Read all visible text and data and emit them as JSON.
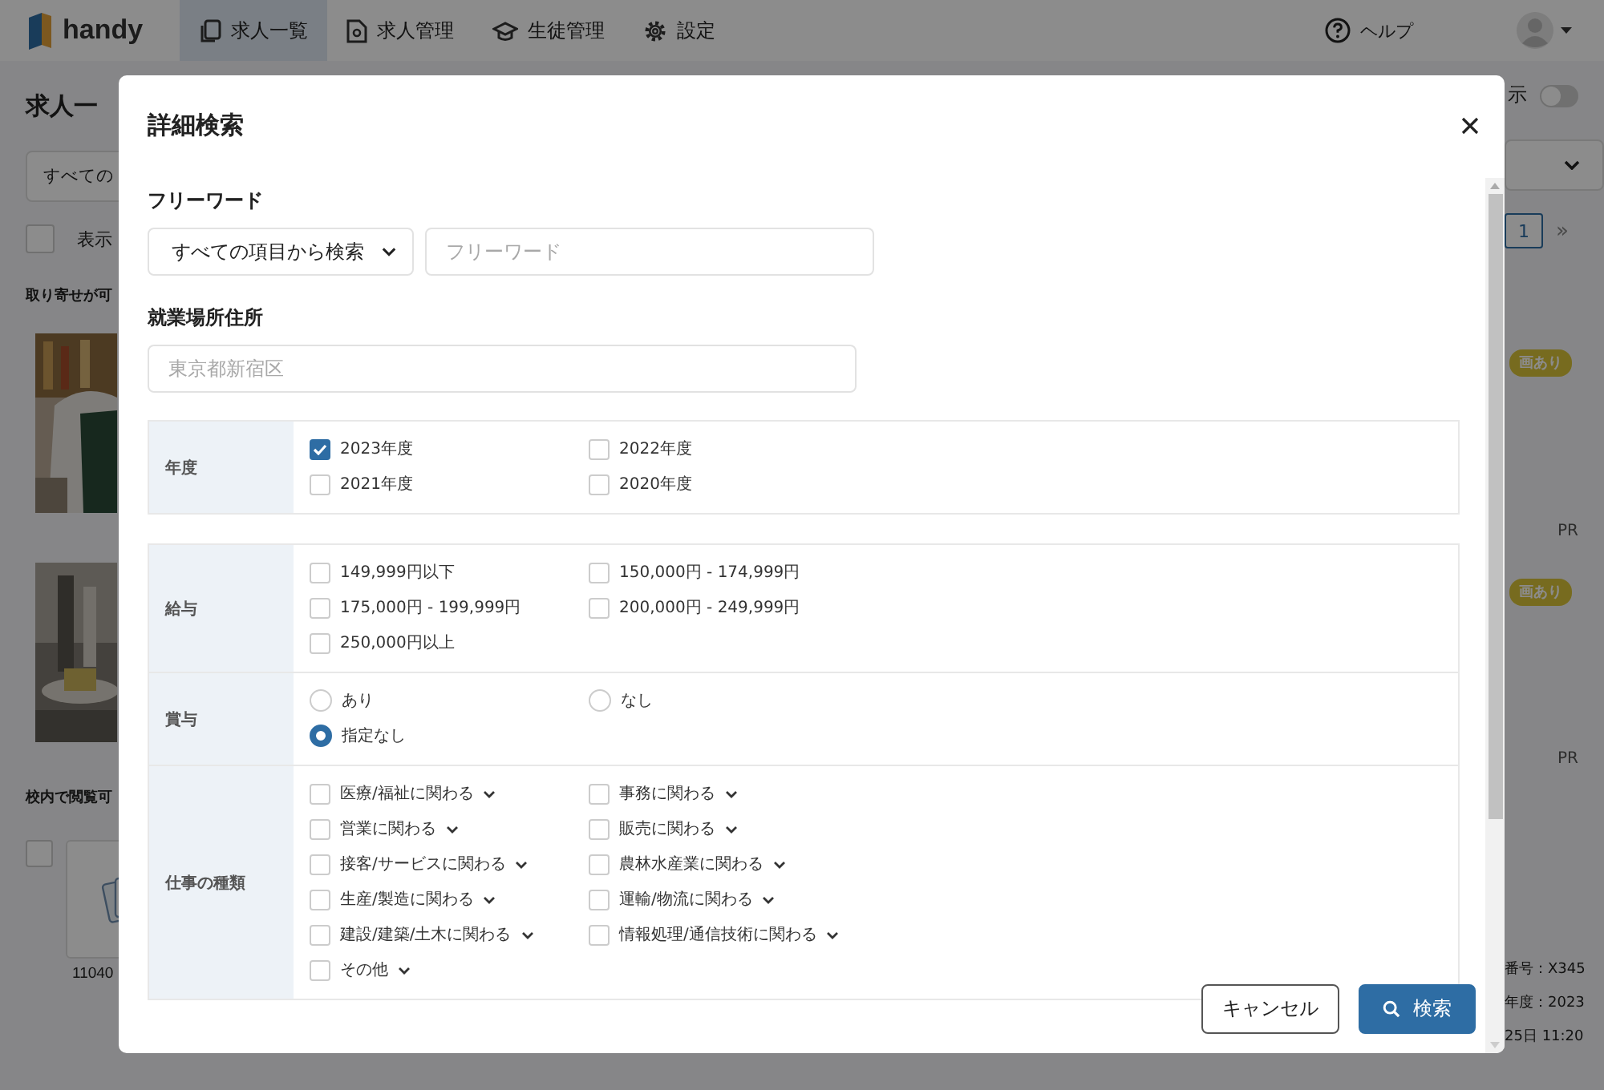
{
  "header": {
    "logo": "handy",
    "nav": [
      {
        "label": "求人一覧",
        "selected": true
      },
      {
        "label": "求人管理",
        "selected": false
      },
      {
        "label": "生徒管理",
        "selected": false
      },
      {
        "label": "設定",
        "selected": false
      }
    ],
    "help": "ヘルプ"
  },
  "page": {
    "title": "求人一",
    "filter": "すべての",
    "select_all": "表示",
    "select_all_checked": false,
    "card_checked": false,
    "section_1": "取り寄せが可",
    "section_2": "校内で閲覧可",
    "card_id": "11040",
    "toggle_label": "示",
    "toggle_on": false,
    "page_number": "1",
    "next": "»",
    "badges": [
      "画あり",
      "画あり"
    ],
    "pr": [
      "PR",
      "PR"
    ],
    "meta": [
      "番号：X345",
      "年度：2023",
      "25日 11:20"
    ]
  },
  "modal": {
    "title": "詳細検索",
    "freeword": {
      "label": "フリーワード",
      "scope": "すべての項目から検索",
      "placeholder": "フリーワード"
    },
    "address": {
      "label": "就業場所住所",
      "placeholder": "東京都新宿区"
    },
    "tables": [
      {
        "rows": [
          {
            "label": "年度",
            "options": [
              {
                "kind": "checkbox",
                "label": "2023年度",
                "checked": true
              },
              {
                "kind": "checkbox",
                "label": "2022年度",
                "checked": false
              },
              {
                "kind": "checkbox",
                "label": "2021年度",
                "checked": false
              },
              {
                "kind": "checkbox",
                "label": "2020年度",
                "checked": false
              }
            ]
          }
        ]
      },
      {
        "rows": [
          {
            "label": "給与",
            "options": [
              {
                "kind": "checkbox",
                "label": "149,999円以下",
                "checked": false
              },
              {
                "kind": "checkbox",
                "label": "150,000円 - 174,999円",
                "checked": false
              },
              {
                "kind": "checkbox",
                "label": "175,000円 - 199,999円",
                "checked": false
              },
              {
                "kind": "checkbox",
                "label": "200,000円 - 249,999円",
                "checked": false
              },
              {
                "kind": "checkbox",
                "label": "250,000円以上",
                "checked": false
              }
            ]
          },
          {
            "label": "賞与",
            "options": [
              {
                "kind": "radio",
                "label": "あり",
                "checked": false
              },
              {
                "kind": "radio",
                "label": "なし",
                "checked": false
              },
              {
                "kind": "radio",
                "label": "指定なし",
                "checked": true
              }
            ]
          },
          {
            "label": "仕事の種類",
            "options": [
              {
                "kind": "expandable",
                "label": "医療/福祉に関わる",
                "checked": false
              },
              {
                "kind": "expandable",
                "label": "事務に関わる",
                "checked": false
              },
              {
                "kind": "expandable",
                "label": "営業に関わる",
                "checked": false
              },
              {
                "kind": "expandable",
                "label": "販売に関わる",
                "checked": false
              },
              {
                "kind": "expandable",
                "label": "接客/サービスに関わる",
                "checked": false
              },
              {
                "kind": "expandable",
                "label": "農林水産業に関わる",
                "checked": false
              },
              {
                "kind": "expandable",
                "label": "生産/製造に関わる",
                "checked": false
              },
              {
                "kind": "expandable",
                "label": "運輸/物流に関わる",
                "checked": false
              },
              {
                "kind": "expandable",
                "label": "建設/建築/土木に関わる",
                "checked": false
              },
              {
                "kind": "expandable",
                "label": "情報処理/通信技術に関わる",
                "checked": false
              },
              {
                "kind": "expandable",
                "label": "その他",
                "checked": false
              }
            ]
          }
        ]
      }
    ],
    "cancel": "キャンセル",
    "search": "検索"
  }
}
